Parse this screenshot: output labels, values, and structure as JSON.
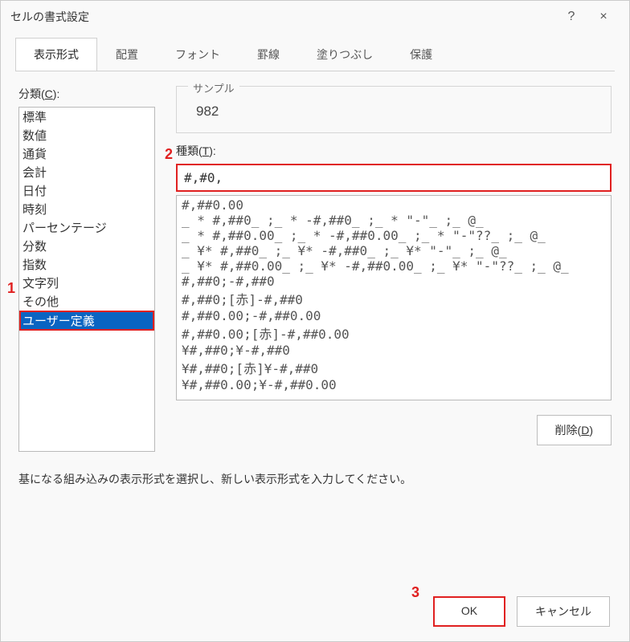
{
  "titlebar": {
    "title": "セルの書式設定",
    "help": "?",
    "close": "×"
  },
  "tabs": [
    {
      "label": "表示形式",
      "active": true
    },
    {
      "label": "配置"
    },
    {
      "label": "フォント"
    },
    {
      "label": "罫線"
    },
    {
      "label": "塗りつぶし"
    },
    {
      "label": "保護"
    }
  ],
  "category": {
    "label_pre": "分類(",
    "label_u": "C",
    "label_post": "):",
    "items": [
      "標準",
      "数値",
      "通貨",
      "会計",
      "日付",
      "時刻",
      "パーセンテージ",
      "分数",
      "指数",
      "文字列",
      "その他",
      "ユーザー定義"
    ],
    "selected": "ユーザー定義"
  },
  "sample": {
    "legend": "サンプル",
    "value": "982"
  },
  "type": {
    "label_pre": "種類(",
    "label_u": "T",
    "label_post": "):",
    "value": "#,#0,",
    "options": [
      "#,##0.00",
      "_ * #,##0_ ;_ * -#,##0_ ;_ * \"-\"_ ;_ @_",
      "_ * #,##0.00_ ;_ * -#,##0.00_ ;_ * \"-\"??_ ;_ @_",
      "_ ¥* #,##0_ ;_ ¥* -#,##0_ ;_ ¥* \"-\"_ ;_ @_",
      "_ ¥* #,##0.00_ ;_ ¥* -#,##0.00_ ;_ ¥* \"-\"??_ ;_ @_",
      "#,##0;-#,##0",
      "#,##0;[赤]-#,##0",
      "#,##0.00;-#,##0.00",
      "#,##0.00;[赤]-#,##0.00",
      "¥#,##0;¥-#,##0",
      "¥#,##0;[赤]¥-#,##0",
      "¥#,##0.00;¥-#,##0.00"
    ]
  },
  "delete": {
    "label_pre": "削除(",
    "label_u": "D",
    "label_post": ")"
  },
  "hint": "基になる組み込みの表示形式を選択し、新しい表示形式を入力してください。",
  "footer": {
    "ok": "OK",
    "cancel": "キャンセル"
  },
  "annotations": {
    "a1": "1",
    "a2": "2",
    "a3": "3"
  }
}
